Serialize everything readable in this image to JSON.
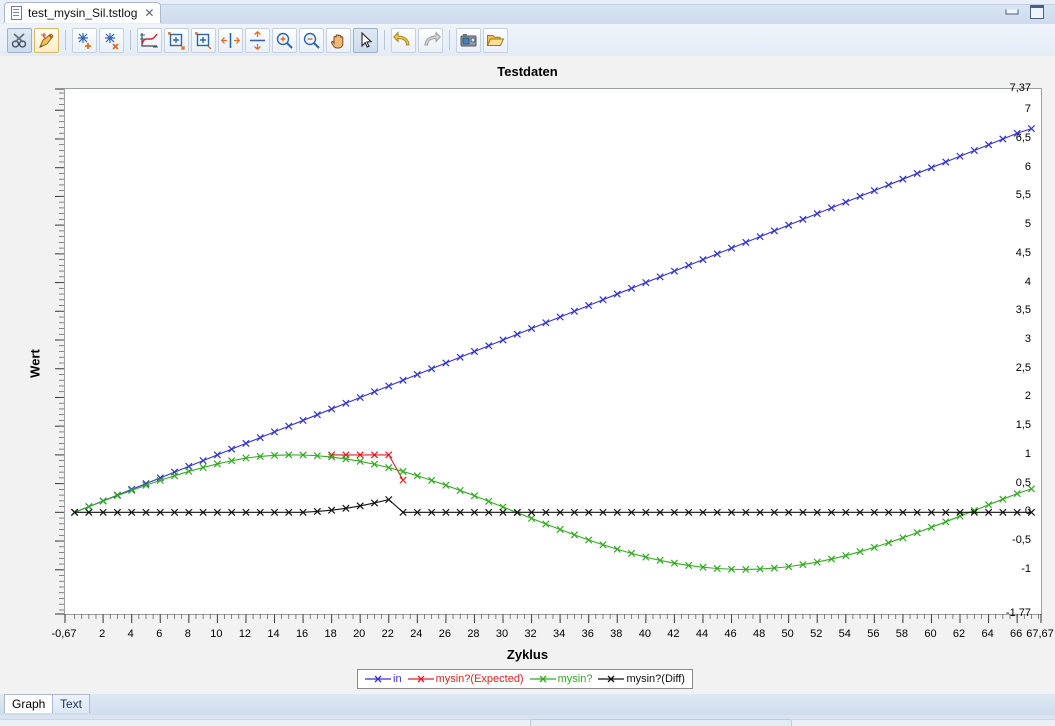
{
  "window": {
    "tab_title": "test_mysin_Sil.tstlog",
    "tab_close": "✕",
    "minimize_label": "Minimize",
    "maximize_label": "Maximize"
  },
  "toolbar": {
    "buttons": [
      {
        "name": "cut-tool-button",
        "icon": "scissors-icon",
        "state": "pressed"
      },
      {
        "name": "marker-tool-button",
        "icon": "highlighter-icon",
        "state": "sel"
      },
      {
        "name": "add-cursor-button",
        "icon": "crosshair-plus-icon",
        "state": "raised"
      },
      {
        "name": "remove-cursor-button",
        "icon": "crosshair-minus-icon",
        "state": "raised"
      },
      {
        "name": "fit-graph-button",
        "icon": "graph-fit-icon",
        "state": "raised"
      },
      {
        "name": "zoom-box-button",
        "icon": "zoom-box-icon",
        "state": "raised"
      },
      {
        "name": "zoom-box-alt-button",
        "icon": "zoom-box-alt-icon",
        "state": "raised"
      },
      {
        "name": "fit-horizontal-button",
        "icon": "fit-horizontal-icon",
        "state": "raised"
      },
      {
        "name": "fit-vertical-button",
        "icon": "fit-vertical-icon",
        "state": "raised"
      },
      {
        "name": "zoom-in-button",
        "icon": "zoom-in-icon",
        "state": "raised"
      },
      {
        "name": "zoom-out-button",
        "icon": "zoom-out-icon",
        "state": "raised"
      },
      {
        "name": "pan-button",
        "icon": "hand-icon",
        "state": "raised"
      },
      {
        "name": "select-button",
        "icon": "arrow-cursor-icon",
        "state": "pressed"
      },
      {
        "name": "undo-button",
        "icon": "undo-arrow-icon",
        "state": "raised"
      },
      {
        "name": "redo-button",
        "icon": "redo-arrow-icon",
        "state": "raised"
      },
      {
        "name": "snapshot-button",
        "icon": "camera-icon",
        "state": "raised"
      },
      {
        "name": "open-file-button",
        "icon": "folder-open-icon",
        "state": "raised"
      }
    ]
  },
  "chart_data": {
    "type": "line",
    "title": "Testdaten",
    "xlabel": "Zyklus",
    "ylabel": "Wert",
    "grid": false,
    "legend_position": "bottom",
    "xlim": [
      -0.67,
      67.67
    ],
    "ylim": [
      -1.77,
      7.37
    ],
    "xticks": [
      "-0,67",
      "2",
      "4",
      "6",
      "8",
      "10",
      "12",
      "14",
      "16",
      "18",
      "20",
      "22",
      "24",
      "26",
      "28",
      "30",
      "32",
      "34",
      "36",
      "38",
      "40",
      "42",
      "44",
      "46",
      "48",
      "50",
      "52",
      "54",
      "56",
      "58",
      "60",
      "62",
      "64",
      "66",
      "67,67"
    ],
    "xtick_values": [
      -0.67,
      2,
      4,
      6,
      8,
      10,
      12,
      14,
      16,
      18,
      20,
      22,
      24,
      26,
      28,
      30,
      32,
      34,
      36,
      38,
      40,
      42,
      44,
      46,
      48,
      50,
      52,
      54,
      56,
      58,
      60,
      62,
      64,
      66,
      67.67
    ],
    "yticks": [
      "7,37",
      "7",
      "6,5",
      "6",
      "5,5",
      "5",
      "4,5",
      "4",
      "3,5",
      "3",
      "2,5",
      "2",
      "1,5",
      "1",
      "0,5",
      "0",
      "-0,5",
      "-1",
      "-1,77"
    ],
    "ytick_values": [
      7.37,
      7,
      6.5,
      6,
      5.5,
      5,
      4.5,
      4,
      3.5,
      3,
      2.5,
      2,
      1.5,
      1,
      0.5,
      0,
      -0.5,
      -1,
      -1.77
    ],
    "series": [
      {
        "name": "in",
        "color": "#3333cc",
        "marker": "x",
        "x": [
          0,
          1,
          2,
          3,
          4,
          5,
          6,
          7,
          8,
          9,
          10,
          11,
          12,
          13,
          14,
          15,
          16,
          17,
          18,
          19,
          20,
          21,
          22,
          23,
          24,
          25,
          26,
          27,
          28,
          29,
          30,
          31,
          32,
          33,
          34,
          35,
          36,
          37,
          38,
          39,
          40,
          41,
          42,
          43,
          44,
          45,
          46,
          47,
          48,
          49,
          50,
          51,
          52,
          53,
          54,
          55,
          56,
          57,
          58,
          59,
          60,
          61,
          62,
          63,
          64,
          65,
          66,
          67
        ],
        "y": [
          0,
          0.1,
          0.2,
          0.3,
          0.4,
          0.5,
          0.6,
          0.7,
          0.8,
          0.9,
          1.0,
          1.1,
          1.2,
          1.3,
          1.4,
          1.5,
          1.6,
          1.7,
          1.8,
          1.9,
          2.0,
          2.1,
          2.2,
          2.3,
          2.4,
          2.5,
          2.6,
          2.7,
          2.8,
          2.9,
          3.0,
          3.1,
          3.2,
          3.3,
          3.4,
          3.5,
          3.6,
          3.7,
          3.8,
          3.9,
          4.0,
          4.1,
          4.2,
          4.3,
          4.4,
          4.5,
          4.6,
          4.7,
          4.8,
          4.9,
          5.0,
          5.1,
          5.2,
          5.3,
          5.4,
          5.5,
          5.6,
          5.7,
          5.8,
          5.9,
          6.0,
          6.1,
          6.2,
          6.3,
          6.4,
          6.5,
          6.6,
          6.68
        ]
      },
      {
        "name": "mysin?(Expected)",
        "color": "#e02020",
        "marker": "x",
        "x": [
          18,
          19,
          20,
          21,
          22,
          23
        ],
        "y": [
          1.0,
          1.0,
          1.0,
          1.0,
          1.0,
          0.56
        ]
      },
      {
        "name": "mysin?",
        "color": "#33aa22",
        "marker": "x",
        "x": [
          0,
          1,
          2,
          3,
          4,
          5,
          6,
          7,
          8,
          9,
          10,
          11,
          12,
          13,
          14,
          15,
          16,
          17,
          18,
          19,
          20,
          21,
          22,
          23,
          24,
          25,
          26,
          27,
          28,
          29,
          30,
          31,
          32,
          33,
          34,
          35,
          36,
          37,
          38,
          39,
          40,
          41,
          42,
          43,
          44,
          45,
          46,
          47,
          48,
          49,
          50,
          51,
          52,
          53,
          54,
          55,
          56,
          57,
          58,
          59,
          60,
          61,
          62,
          63,
          64,
          65,
          66,
          67
        ],
        "y": [
          0,
          0.098,
          0.195,
          0.29,
          0.382,
          0.471,
          0.556,
          0.637,
          0.712,
          0.781,
          0.843,
          0.898,
          0.945,
          0.974,
          0.992,
          1.0,
          0.998,
          0.985,
          0.963,
          0.93,
          0.888,
          0.837,
          0.778,
          0.711,
          0.637,
          0.557,
          0.471,
          0.381,
          0.288,
          0.191,
          0.093,
          -0.006,
          -0.105,
          -0.203,
          -0.299,
          -0.392,
          -0.481,
          -0.565,
          -0.643,
          -0.715,
          -0.78,
          -0.837,
          -0.885,
          -0.925,
          -0.956,
          -0.978,
          -0.991,
          -0.994,
          -0.987,
          -0.971,
          -0.945,
          -0.91,
          -0.866,
          -0.813,
          -0.753,
          -0.685,
          -0.61,
          -0.53,
          -0.444,
          -0.354,
          -0.261,
          -0.165,
          -0.067,
          0.032,
          0.131,
          0.229,
          0.325,
          0.408
        ]
      },
      {
        "name": "mysin?(Diff)",
        "color": "#111111",
        "marker": "x",
        "x": [
          0,
          1,
          2,
          3,
          4,
          5,
          6,
          7,
          8,
          9,
          10,
          11,
          12,
          13,
          14,
          15,
          16,
          17,
          18,
          19,
          20,
          21,
          22,
          23,
          24,
          25,
          26,
          27,
          28,
          29,
          30,
          31,
          32,
          33,
          34,
          35,
          36,
          37,
          38,
          39,
          40,
          41,
          42,
          43,
          44,
          45,
          46,
          47,
          48,
          49,
          50,
          51,
          52,
          53,
          54,
          55,
          56,
          57,
          58,
          59,
          60,
          61,
          62,
          63,
          64,
          65,
          66,
          67
        ],
        "y": [
          0,
          0,
          0,
          0,
          0,
          0,
          0,
          0,
          0,
          0,
          0,
          0,
          0,
          0,
          0,
          0,
          0,
          0.015,
          0.037,
          0.07,
          0.112,
          0.163,
          0.222,
          0,
          0,
          0,
          0,
          0,
          0,
          0,
          0,
          0,
          0,
          0,
          0,
          0,
          0,
          0,
          0,
          0,
          0,
          0,
          0,
          0,
          0,
          0,
          0,
          0,
          0,
          0,
          0,
          0,
          0,
          0,
          0,
          0,
          0,
          0,
          0,
          0,
          0,
          0,
          0,
          0,
          0,
          0,
          0,
          0
        ]
      }
    ]
  },
  "bottom_tabs": [
    {
      "label": "Graph",
      "active": true
    },
    {
      "label": "Text",
      "active": false
    }
  ]
}
